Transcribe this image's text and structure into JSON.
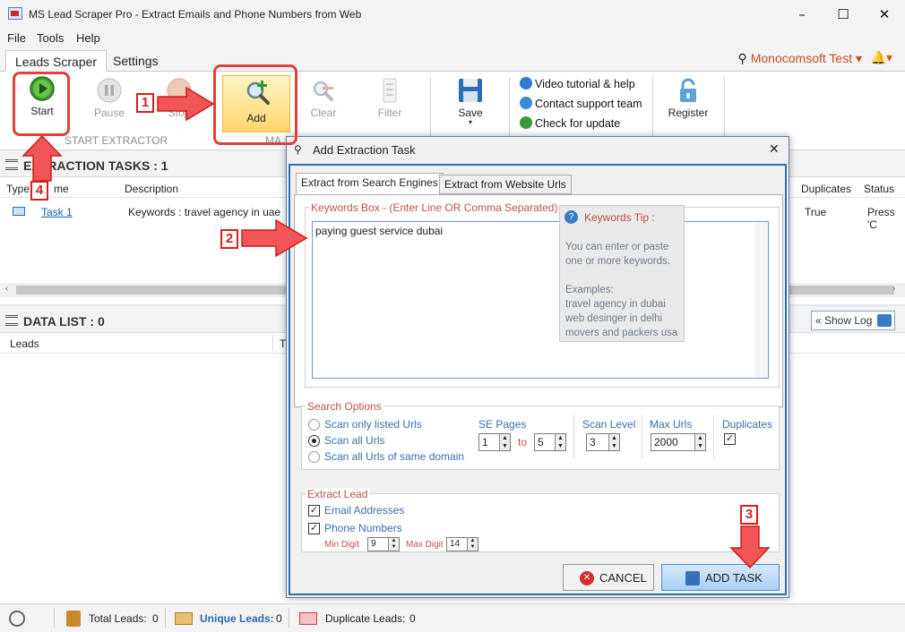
{
  "window": {
    "title": "MS Lead Scraper Pro - Extract Emails and Phone Numbers from Web",
    "minimize": "–",
    "maximize": "☐",
    "close": "✕"
  },
  "menu": {
    "items": [
      "File",
      "Tools",
      "Help"
    ]
  },
  "tabs": {
    "items": [
      "Leads Scraper",
      "Settings"
    ],
    "active": "Leads Scraper"
  },
  "user": {
    "name": "Monocomsoft Test ▾",
    "bell": "▾"
  },
  "ribbon": {
    "start": "Start",
    "pause": "Pause",
    "stop": "Stop",
    "add": "Add",
    "clear": "Clear",
    "filter": "Filter",
    "save": "Save",
    "save_arrow": "▾",
    "group_start": "START EXTRACTOR",
    "group_manage": "MA",
    "links": [
      "Video tutorial & help",
      "Contact support team",
      "Check for update"
    ],
    "register": "Register"
  },
  "tasks_panel": {
    "title": "EXTRACTION TASKS : 1",
    "columns": [
      "Type",
      "me",
      "Description",
      "Duplicates",
      "Status"
    ],
    "row": {
      "name": "Task 1",
      "description": "Keywords : travel agency in uae",
      "duplicates": "True",
      "status": "Press 'C"
    }
  },
  "data_panel": {
    "title": "DATA LIST : 0",
    "columns": [
      "Leads",
      "T"
    ],
    "show_log": "« Show Log"
  },
  "dialog": {
    "title": "Add Extraction Task",
    "close": "✕",
    "tabs": [
      "Extract from Search Engines",
      "Extract from Website Urls"
    ],
    "keywords_legend": "Keywords Box - (Enter Line OR Comma Separated)",
    "keywords_value": "paying guest service dubai",
    "tip": {
      "title": "Keywords Tip :",
      "line1": "You can enter or paste",
      "line2": "one or more keywords.",
      "examples_label": "Examples:",
      "examples": [
        "travel agency in dubai",
        "web desinger in delhi",
        "movers and packers usa"
      ]
    },
    "search_options": {
      "legend": "Search Options",
      "radios": [
        "Scan only listed Urls",
        "Scan all Urls",
        "Scan all Urls of same domain"
      ],
      "selected_index": 1,
      "se_pages_label": "SE Pages",
      "se_from": "1",
      "to_label": "to",
      "se_to": "5",
      "scan_level_label": "Scan Level",
      "scan_level": "3",
      "max_urls_label": "Max Urls",
      "max_urls": "2000",
      "duplicates_label": "Duplicates",
      "duplicates_checked": true
    },
    "extract_lead": {
      "legend": "Extract Lead",
      "email": "Email Addresses",
      "phone": "Phone Numbers",
      "min_digit_label": "Min Digit",
      "min_digit": "9",
      "max_digit_label": "Max Digit",
      "max_digit": "14"
    },
    "cancel": "CANCEL",
    "add_task": "ADD TASK"
  },
  "annotations": [
    "1",
    "2",
    "3",
    "4"
  ],
  "status_bar": {
    "total_label": "Total Leads:",
    "total": "0",
    "unique_label": "Unique Leads:",
    "unique": "0",
    "duplicate_label": "Duplicate Leads:",
    "duplicate": "0"
  },
  "colors": {
    "accent": "#2f6fa7",
    "annotation": "#e04040",
    "brand_orange": "#c94d1e"
  }
}
